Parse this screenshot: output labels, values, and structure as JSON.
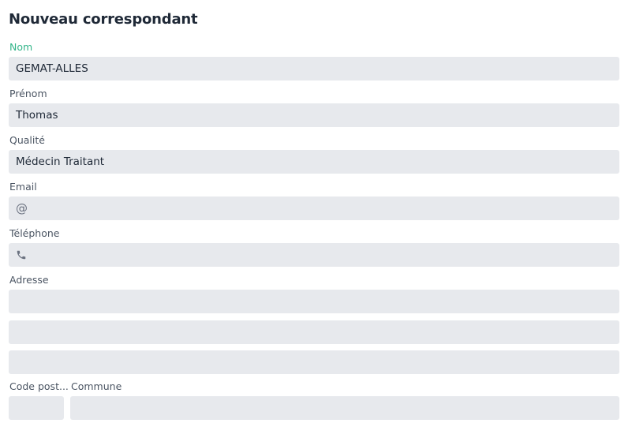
{
  "form": {
    "title": "Nouveau correspondant",
    "fields": {
      "nom": {
        "label": "Nom",
        "value": "GEMAT-ALLES"
      },
      "prenom": {
        "label": "Prénom",
        "value": "Thomas"
      },
      "qualite": {
        "label": "Qualité",
        "value": "Médecin Traitant"
      },
      "email": {
        "label": "Email",
        "value": "",
        "icon": "at-icon",
        "icon_glyph": "@"
      },
      "telephone": {
        "label": "Téléphone",
        "value": "",
        "icon": "phone-icon"
      },
      "adresse": {
        "label": "Adresse",
        "line1": "",
        "line2": "",
        "line3": ""
      },
      "code_postal": {
        "label": "Code post...",
        "value": ""
      },
      "commune": {
        "label": "Commune",
        "value": ""
      }
    }
  },
  "colors": {
    "active_label": "#34b58a",
    "label": "#4b5563",
    "field_bg": "#e7e9ed",
    "title": "#1f2937"
  }
}
